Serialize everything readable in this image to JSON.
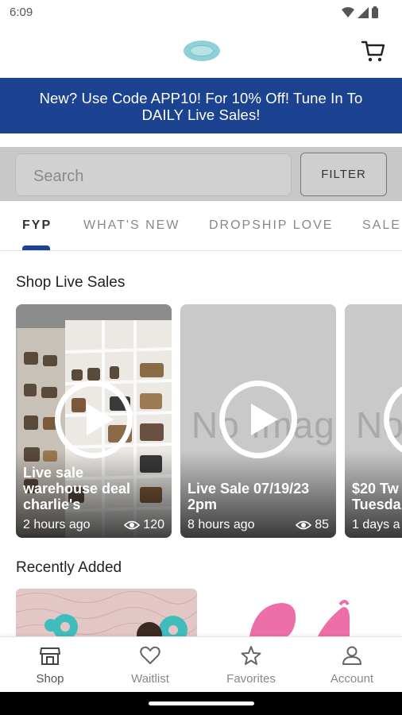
{
  "status_bar": {
    "time": "6:09"
  },
  "header": {
    "logo_icon": "boutique-logo-icon",
    "cart_icon": "cart-icon"
  },
  "promo": {
    "line1": "New? Use Code APP10! For 10% Off! Tune In To",
    "line2": "DAILY Live Sales!",
    "background": "#1c4391"
  },
  "search": {
    "placeholder": "Search",
    "filter_label": "FILTER"
  },
  "tabs": [
    {
      "label": "FYP",
      "active": true
    },
    {
      "label": "WHAT'S NEW",
      "active": false
    },
    {
      "label": "DROPSHIP LOVE",
      "active": false
    },
    {
      "label": "SALE",
      "active": false
    }
  ],
  "live_sales": {
    "title": "Shop Live Sales",
    "cards": [
      {
        "title_line1": "Live sale",
        "title_line2": "warehouse deal",
        "title_line3": "charlie's",
        "time": "2 hours ago",
        "views": "120",
        "image": "store-shelves-photo"
      },
      {
        "title_line1": "Live Sale 07/19/23",
        "title_line2": "2pm",
        "time": "8 hours ago",
        "views": "85",
        "image": "No Image"
      },
      {
        "title_line1": "$20 Tw",
        "title_line2": "Tuesda",
        "time": "1 days a",
        "image": "No Image"
      }
    ]
  },
  "recently_added": {
    "title": "Recently Added"
  },
  "bottom_nav": [
    {
      "label": "Shop",
      "icon": "shop-icon",
      "active": true
    },
    {
      "label": "Waitlist",
      "icon": "heart-icon",
      "active": false
    },
    {
      "label": "Favorites",
      "icon": "star-icon",
      "active": false
    },
    {
      "label": "Account",
      "icon": "person-icon",
      "active": false
    }
  ]
}
